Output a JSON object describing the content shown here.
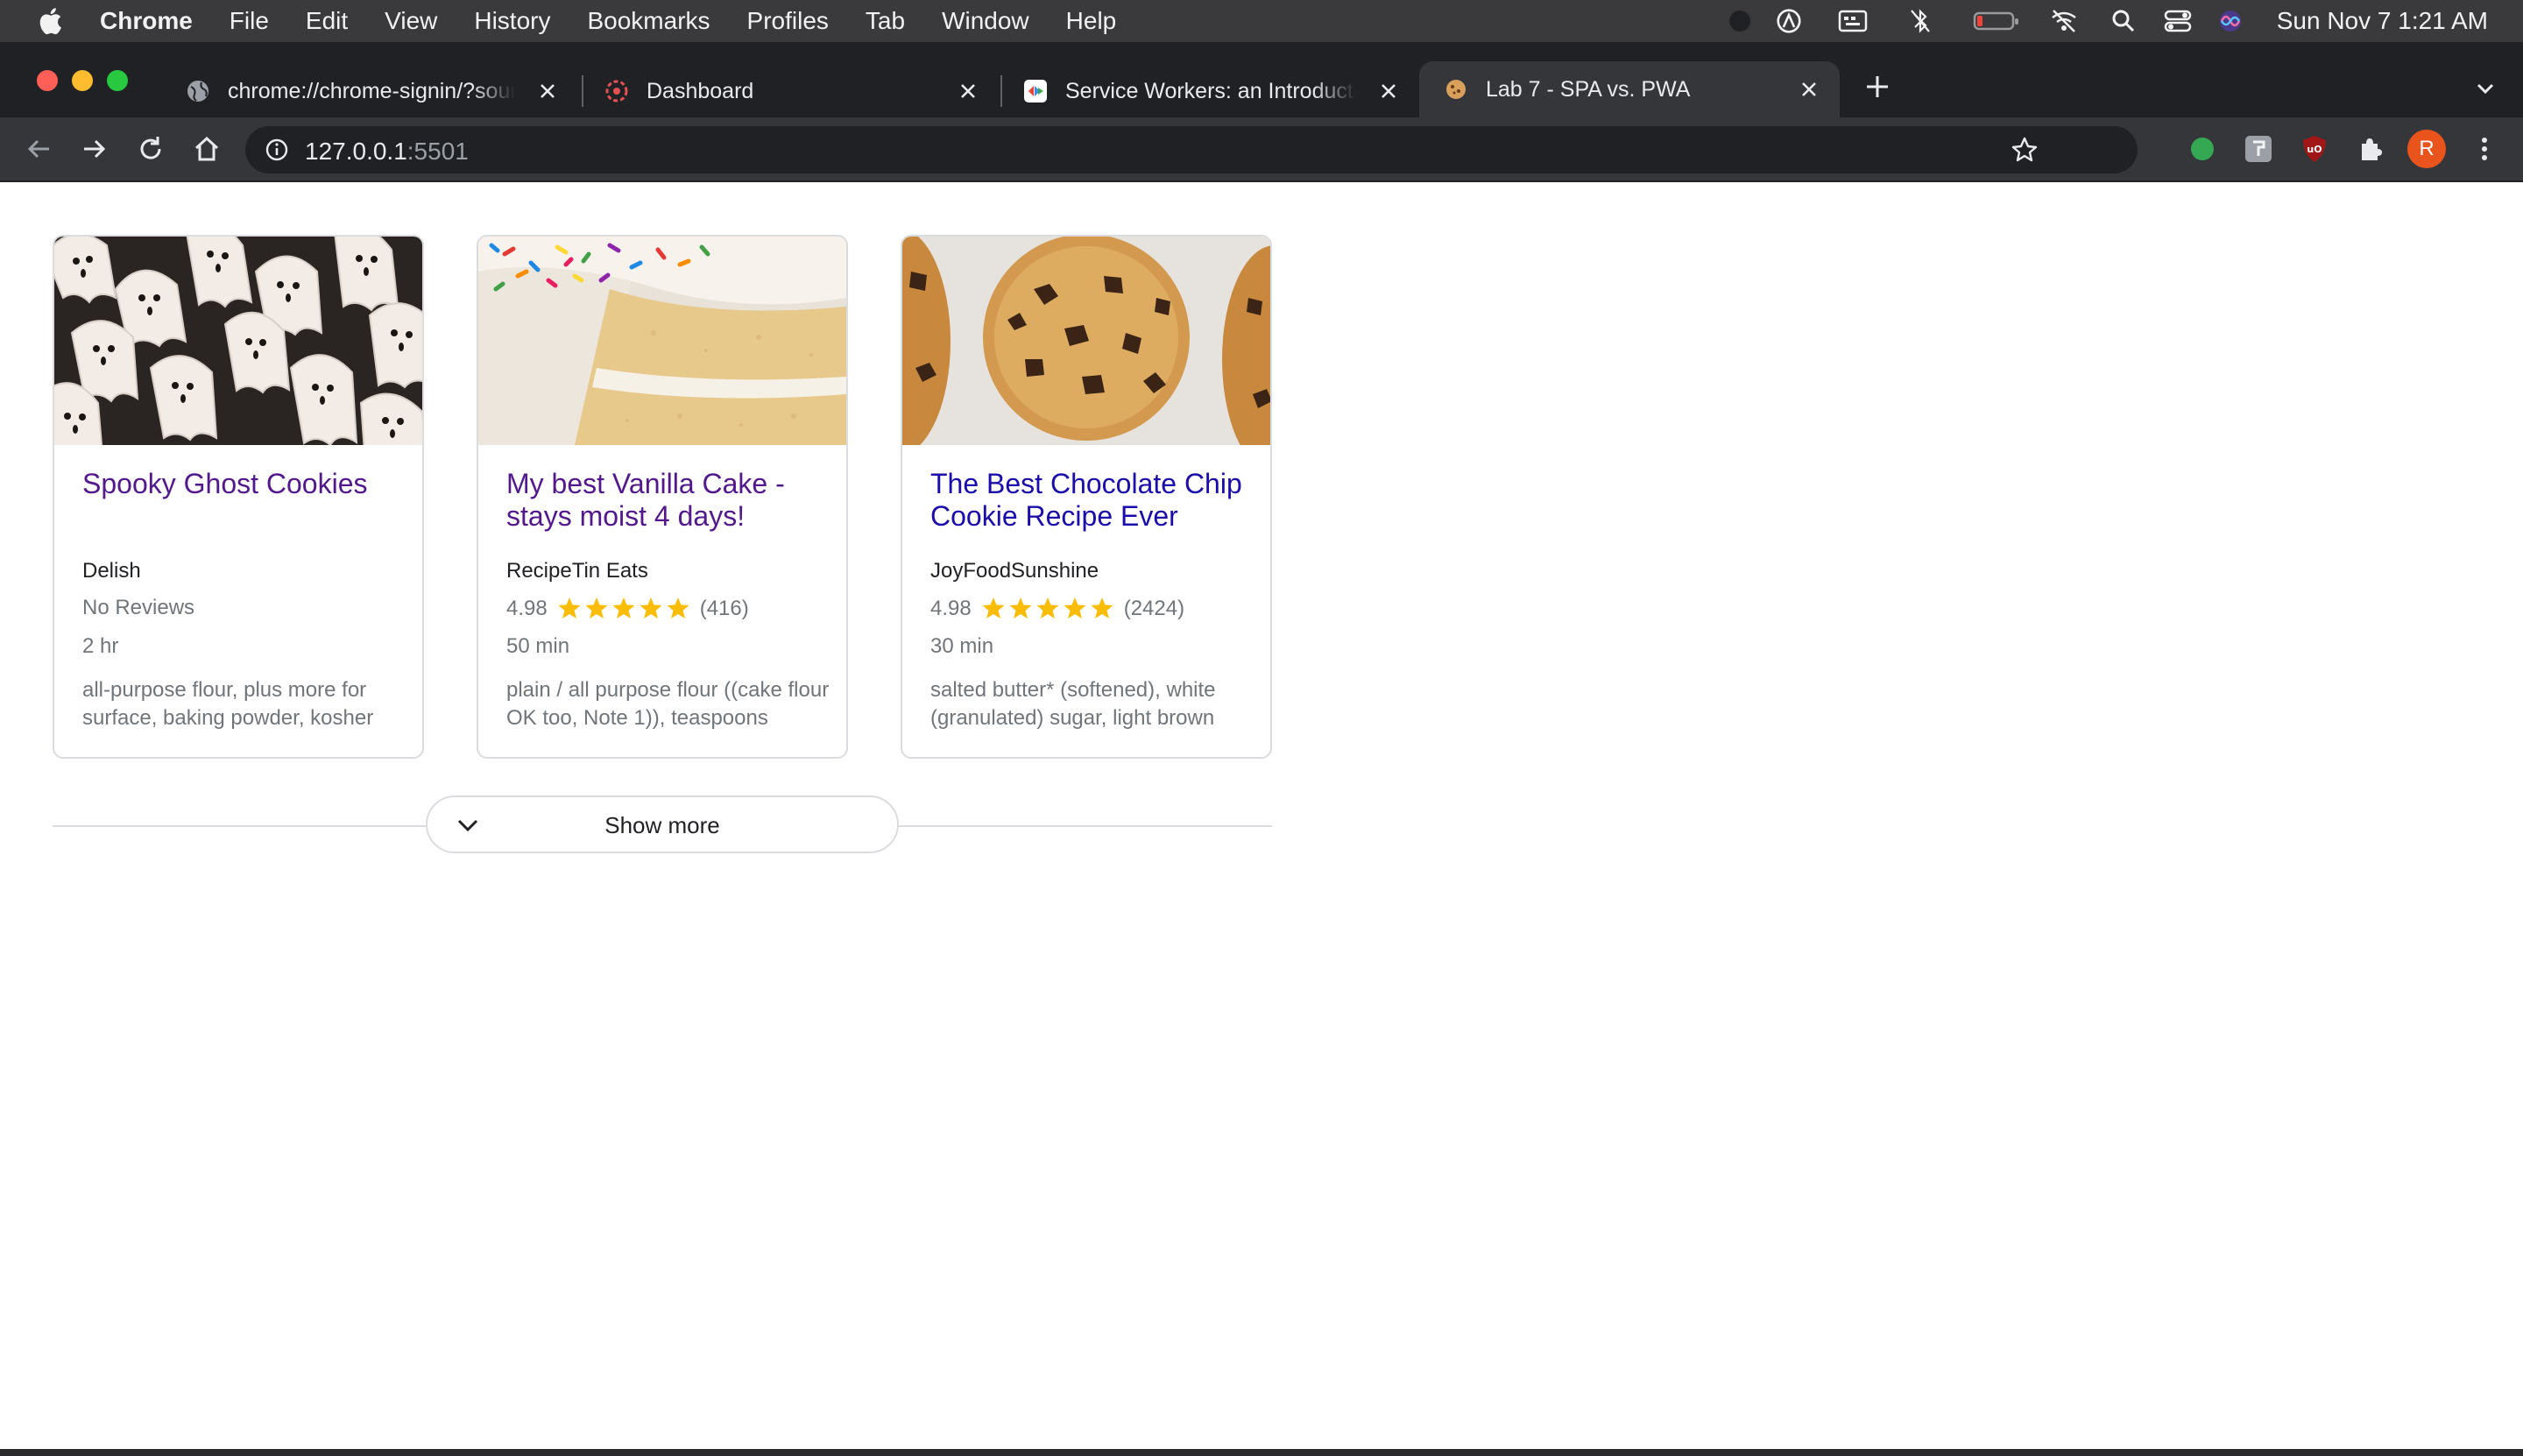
{
  "menubar": {
    "app_name": "Chrome",
    "menus": [
      "File",
      "Edit",
      "View",
      "History",
      "Bookmarks",
      "Profiles",
      "Tab",
      "Window",
      "Help"
    ],
    "clock": "Sun Nov 7  1:21 AM",
    "status_icons": [
      "record-icon",
      "profile-circle-icon",
      "keyboard-input-icon",
      "bluetooth-off-icon",
      "battery-icon",
      "wifi-off-icon",
      "spotlight-search-icon",
      "control-center-icon",
      "siri-icon"
    ]
  },
  "tabs": [
    {
      "title": "chrome://chrome-signin/?source",
      "icon": "globe-icon",
      "active": false
    },
    {
      "title": "Dashboard",
      "icon": "dashboard-favicon-icon",
      "active": false
    },
    {
      "title": "Service Workers: an Introduction",
      "icon": "web-dev-favicon-icon",
      "active": false
    },
    {
      "title": "Lab 7 - SPA vs. PWA",
      "icon": "cookie-favicon-icon",
      "active": true
    }
  ],
  "toolbar": {
    "url_host": "127.0.0.1",
    "url_port": ":5501",
    "profile_initial": "R",
    "extensions": [
      "green-dot-extension-icon",
      "grey-extension-icon",
      "ublock-origin-icon",
      "puzzle-extensions-icon"
    ]
  },
  "colors": {
    "visited_link": "#52188c",
    "link": "#1a0dab",
    "star": "#fbbc04",
    "profile": "#e8541c"
  },
  "recipes": [
    {
      "title": "Spooky Ghost Cookies",
      "visited": true,
      "source": "Delish",
      "rating_text": "No Reviews",
      "rating_value": "",
      "review_count": "",
      "time": "2 hr",
      "ingredients": "all-purpose flour, plus more for surface, baking powder, kosher"
    },
    {
      "title": "My best Vanilla Cake - stays moist 4 days!",
      "visited": true,
      "source": "RecipeTin Eats",
      "rating_text": "",
      "rating_value": "4.98",
      "review_count": "(416)",
      "time": "50 min",
      "ingredients": "plain / all purpose flour ((cake flour OK too, Note 1)), teaspoons"
    },
    {
      "title": "The Best Chocolate Chip Cookie Recipe Ever",
      "visited": false,
      "source": "JoyFoodSunshine",
      "rating_text": "",
      "rating_value": "4.98",
      "review_count": "(2424)",
      "time": "30 min",
      "ingredients": "salted butter* (softened), white (granulated) sugar, light brown"
    }
  ],
  "show_more_label": "Show more"
}
